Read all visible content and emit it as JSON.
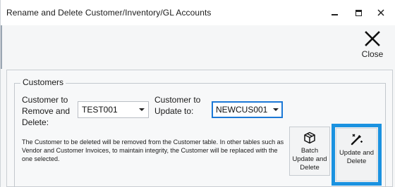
{
  "window": {
    "title": "Rename and Delete Customer/Inventory/GL Accounts",
    "minimize_icon": "minimize-icon",
    "maximize_icon": "maximize-icon",
    "close_icon": "close-icon"
  },
  "toolbar": {
    "close_label": "Close",
    "close_icon": "close-x-icon"
  },
  "customers": {
    "group_title": "Customers",
    "remove_label": "Customer to\nRemove and\nDelete:",
    "remove_value": "TEST001",
    "update_label": "Customer to\nUpdate to:",
    "update_value": "NEWCUS001",
    "description": "The Customer to be deleted will be removed from the Customer table. In other tables such as Vendor and Customer Invoices, to maintain integrity, the Customer will be replaced with the one selected.",
    "batch_button_label": "Batch\nUpdate and\nDelete",
    "batch_button_icon": "box-icon",
    "update_button_label": "Update and\nDelete",
    "update_button_icon": "magic-wand-icon"
  },
  "colors": {
    "highlight_border": "#1b92e0",
    "focus_border": "#1b78d6"
  }
}
